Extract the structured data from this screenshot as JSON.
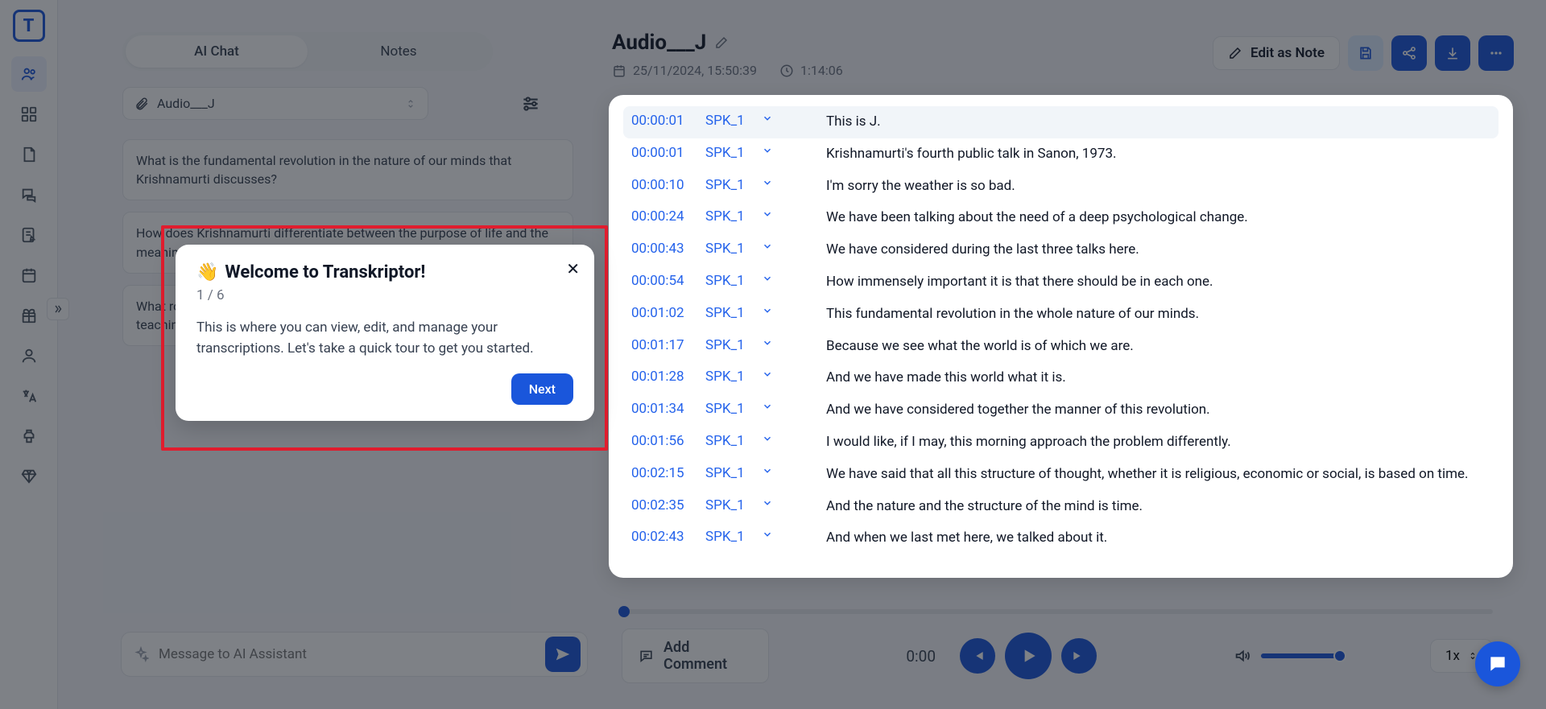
{
  "sidebar": {
    "logo_letter": "T"
  },
  "leftPanel": {
    "tabs": {
      "chat": "AI Chat",
      "notes": "Notes"
    },
    "fileName": "Audio___J",
    "suggestions": [
      "What is the fundamental revolution in the nature of our minds that Krishnamurti discusses?",
      "How does Krishnamurti differentiate between the purpose of life and the meaning of life?",
      "What role does observation without the observer play in Krishnamurti's teachings?"
    ],
    "inputPlaceholder": "Message to AI Assistant"
  },
  "header": {
    "title": "Audio___J",
    "date": "25/11/2024, 15:50:39",
    "duration": "1:14:06",
    "editNote": "Edit as Note"
  },
  "transcript": [
    {
      "ts": "00:00:01",
      "spk": "SPK_1",
      "text": "This is J."
    },
    {
      "ts": "00:00:01",
      "spk": "SPK_1",
      "text": "Krishnamurti's fourth public talk in Sanon, 1973."
    },
    {
      "ts": "00:00:10",
      "spk": "SPK_1",
      "text": "I'm sorry the weather is so bad."
    },
    {
      "ts": "00:00:24",
      "spk": "SPK_1",
      "text": "We have been talking about the need of a deep psychological change."
    },
    {
      "ts": "00:00:43",
      "spk": "SPK_1",
      "text": "We have considered during the last three talks here."
    },
    {
      "ts": "00:00:54",
      "spk": "SPK_1",
      "text": "How immensely important it is that there should be in each one."
    },
    {
      "ts": "00:01:02",
      "spk": "SPK_1",
      "text": "This fundamental revolution in the whole nature of our minds."
    },
    {
      "ts": "00:01:17",
      "spk": "SPK_1",
      "text": "Because we see what the world is of which we are."
    },
    {
      "ts": "00:01:28",
      "spk": "SPK_1",
      "text": "And we have made this world what it is."
    },
    {
      "ts": "00:01:34",
      "spk": "SPK_1",
      "text": "And we have considered together the manner of this revolution."
    },
    {
      "ts": "00:01:56",
      "spk": "SPK_1",
      "text": "I would like, if I may, this morning approach the problem differently."
    },
    {
      "ts": "00:02:15",
      "spk": "SPK_1",
      "text": "We have said that all this structure of thought, whether it is religious, economic or social, is based on time."
    },
    {
      "ts": "00:02:35",
      "spk": "SPK_1",
      "text": "And the nature and the structure of the mind is time."
    },
    {
      "ts": "00:02:43",
      "spk": "SPK_1",
      "text": "And when we last met here, we talked about it."
    }
  ],
  "tour": {
    "title": "Welcome to Transkriptor!",
    "wave": "👋",
    "step": "1 / 6",
    "body": "This is where you can view, edit, and manage your transcriptions. Let's take a quick tour to get you started.",
    "next": "Next"
  },
  "player": {
    "addComment": "Add Comment",
    "currentTime": "0:00",
    "speed": "1x"
  }
}
